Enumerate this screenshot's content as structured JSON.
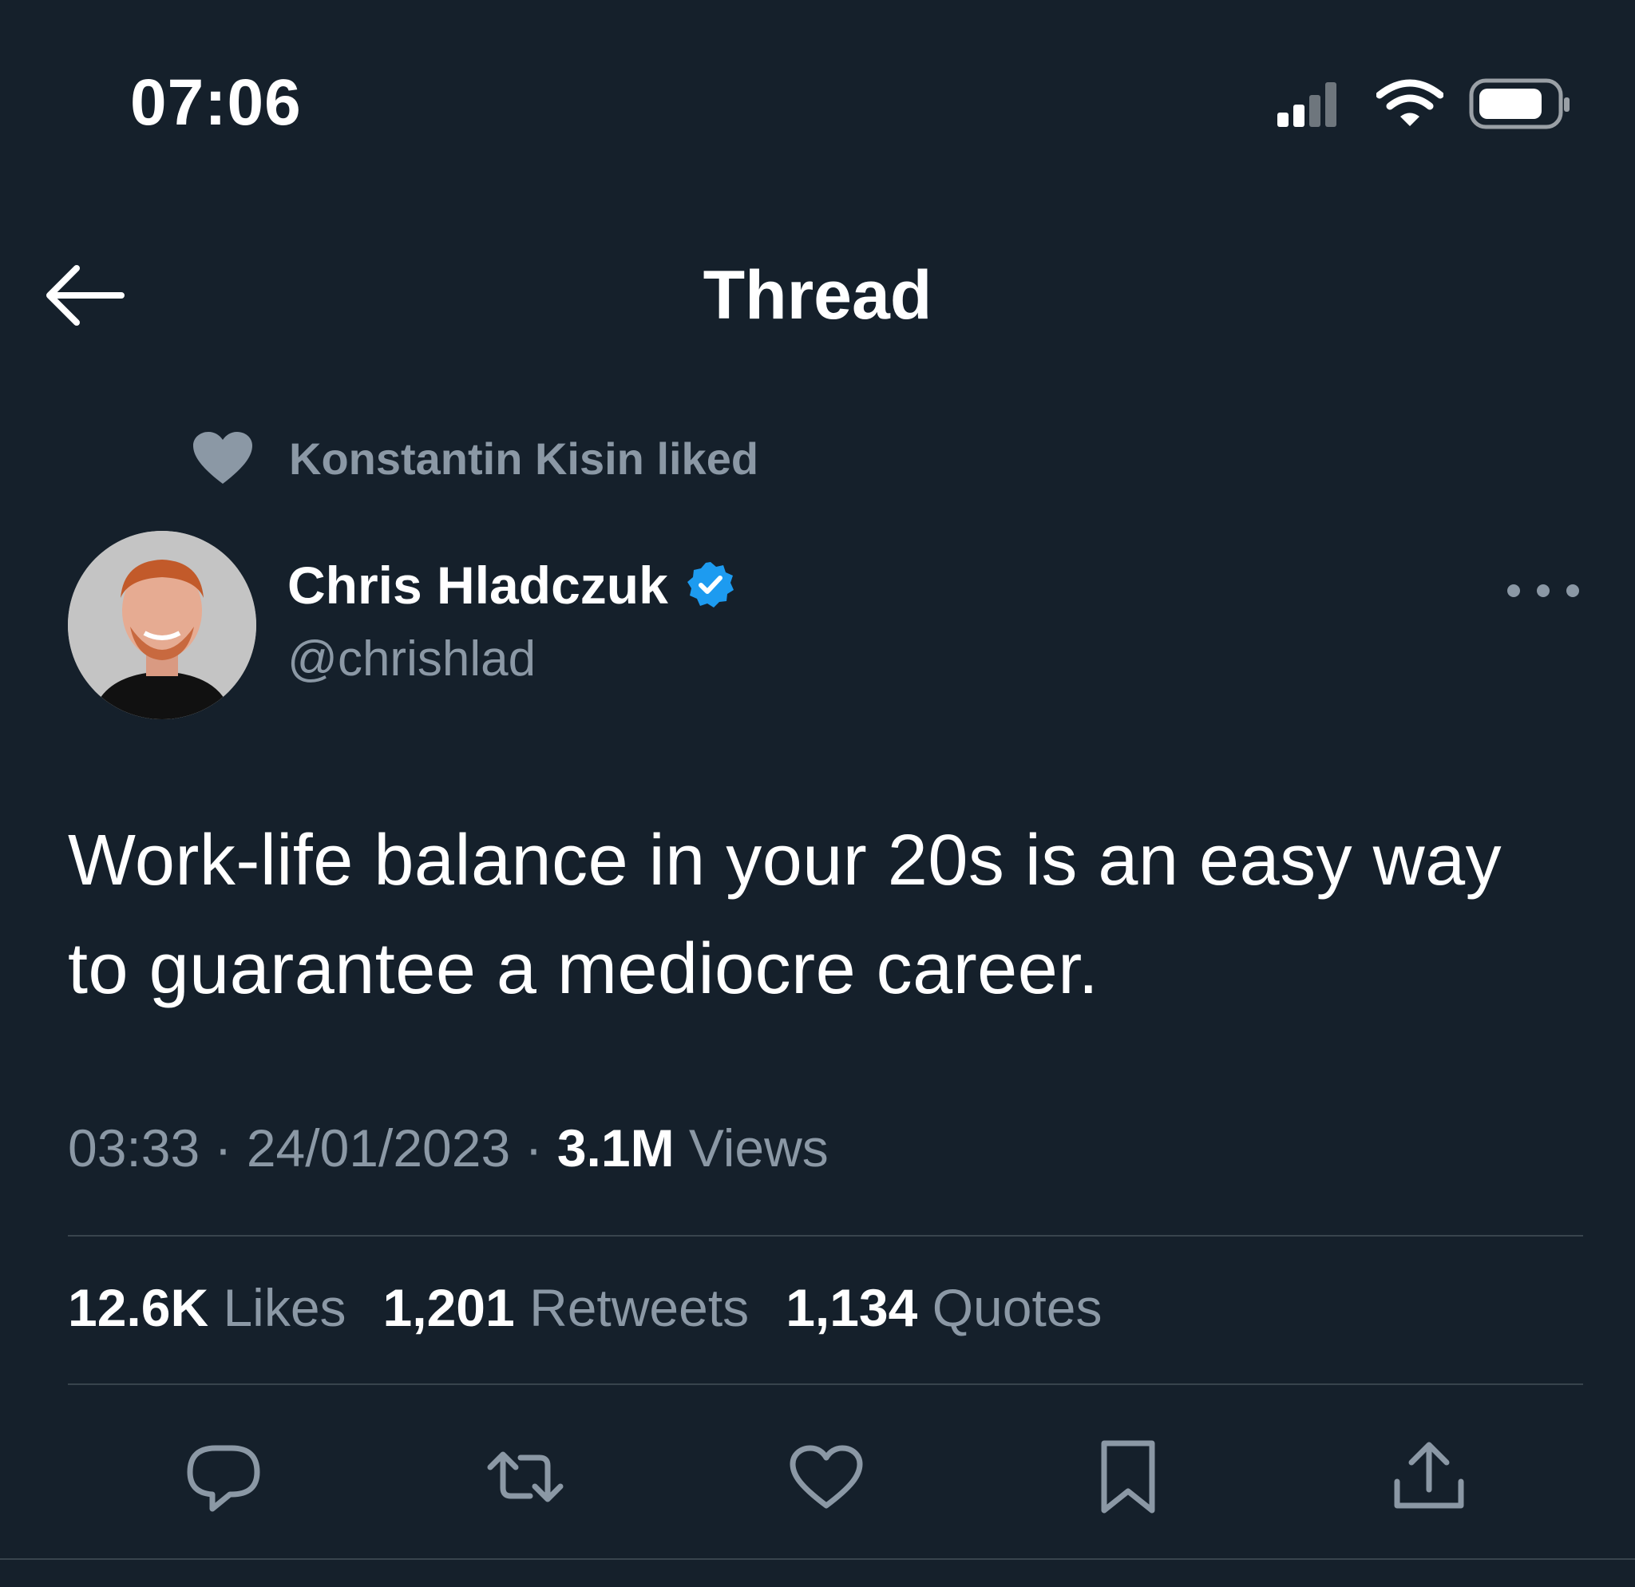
{
  "status_bar": {
    "time": "07:06",
    "icons": [
      "cellular-signal-icon",
      "wifi-icon",
      "battery-icon"
    ]
  },
  "header": {
    "back_icon": "arrow-left-icon",
    "title": "Thread"
  },
  "social_context": {
    "icon": "heart-filled-icon",
    "text": "Konstantin Kisin liked"
  },
  "author": {
    "name": "Chris Hladczuk",
    "handle": "@chrishlad",
    "verified": true,
    "verified_color": "#1d9bf0"
  },
  "tweet": {
    "text": "Work-life balance in your 20s is an easy way to guarantee a mediocre career."
  },
  "meta": {
    "time": "03:33",
    "separator": "·",
    "date": "24/01/2023",
    "views_count": "3.1M",
    "views_label": "Views"
  },
  "stats": {
    "likes_count": "12.6K",
    "likes_label": "Likes",
    "retweets_count": "1,201",
    "retweets_label": "Retweets",
    "quotes_count": "1,134",
    "quotes_label": "Quotes"
  },
  "actions": [
    "reply-icon",
    "retweet-icon",
    "like-icon",
    "bookmark-icon",
    "share-icon"
  ],
  "colors": {
    "background": "#15202b",
    "secondary_text": "#8b98a5",
    "divider": "#38444d"
  }
}
